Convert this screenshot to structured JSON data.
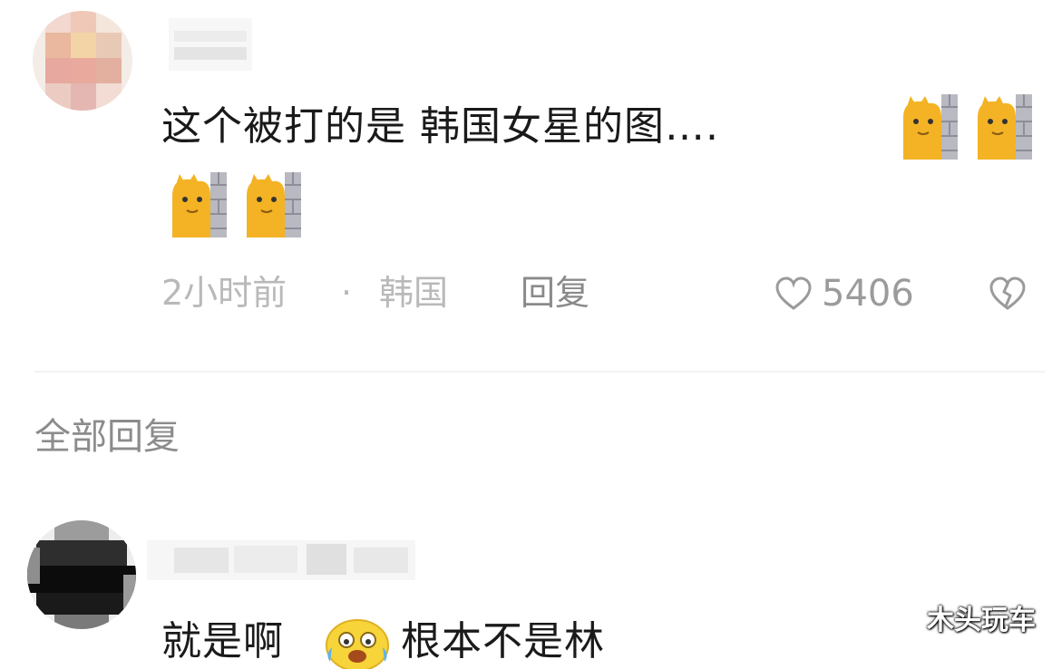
{
  "comment": {
    "text_line1": "这个被打的是 韩国女星的图….",
    "time": "2小时前",
    "separator": "·",
    "location": "韩国",
    "reply_label": "回复",
    "like_count": "5406"
  },
  "replies_section": {
    "title": "全部回复"
  },
  "reply": {
    "text_part1": "就是啊",
    "text_part2": "根本不是林"
  },
  "watermark": "木头玩车",
  "icons": {
    "like": "heart-outline-icon",
    "dislike": "broken-heart-icon",
    "sticker": "cat-peeking-sticker",
    "emoji": "crying-laugh-emoji"
  }
}
